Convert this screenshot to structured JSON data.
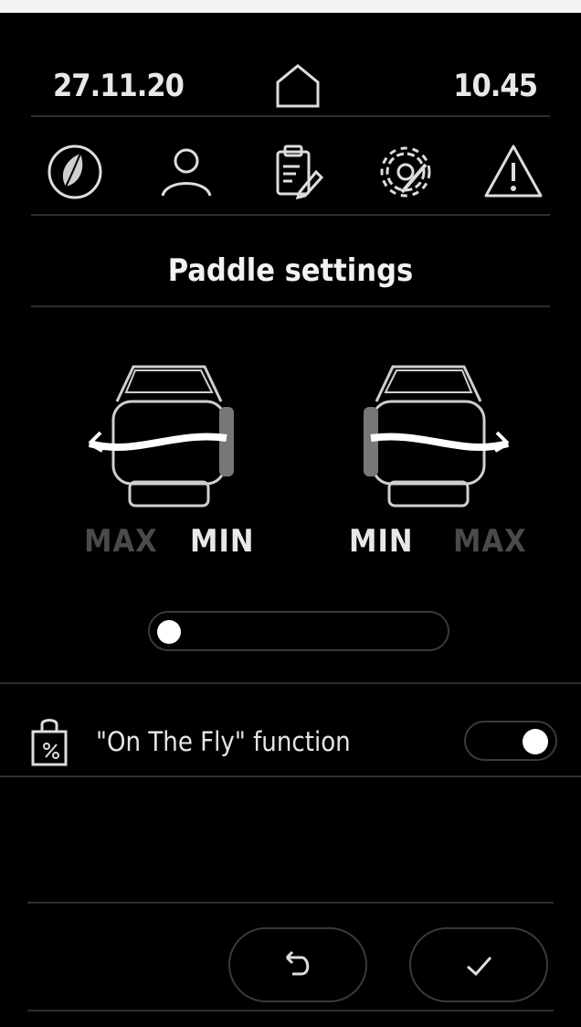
{
  "status_bar": {
    "date": "27.11.20",
    "time": "10.45"
  },
  "icons": [
    "leaf-icon",
    "user-icon",
    "clipboard-edit-icon",
    "settings-gear-icon",
    "warning-icon"
  ],
  "page": {
    "title": "Paddle settings"
  },
  "paddles": {
    "left": {
      "max_label": "MAX",
      "min_label": "MIN"
    },
    "right": {
      "min_label": "MIN",
      "max_label": "MAX"
    }
  },
  "slider": {
    "value_fraction": 0.0
  },
  "on_the_fly": {
    "label": "\"On The Fly\" function",
    "enabled": true
  },
  "buttons": [
    "back-button",
    "confirm-button"
  ],
  "colors": {
    "background": "#000000",
    "text": "#ffffff",
    "dim_text": "#4a4a4a",
    "outline": "#3a3a3a"
  }
}
